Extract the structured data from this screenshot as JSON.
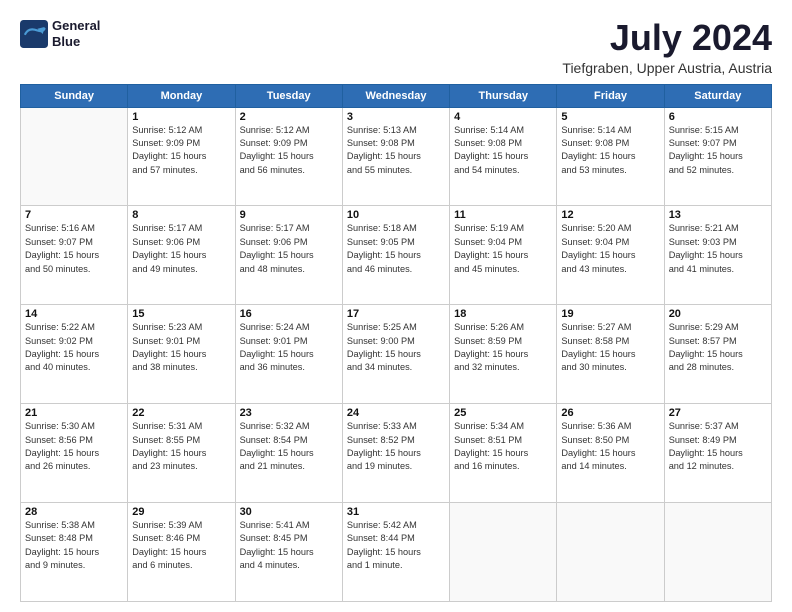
{
  "logo": {
    "line1": "General",
    "line2": "Blue"
  },
  "title": "July 2024",
  "subtitle": "Tiefgraben, Upper Austria, Austria",
  "days_header": [
    "Sunday",
    "Monday",
    "Tuesday",
    "Wednesday",
    "Thursday",
    "Friday",
    "Saturday"
  ],
  "weeks": [
    [
      {
        "day": "",
        "info": ""
      },
      {
        "day": "1",
        "info": "Sunrise: 5:12 AM\nSunset: 9:09 PM\nDaylight: 15 hours\nand 57 minutes."
      },
      {
        "day": "2",
        "info": "Sunrise: 5:12 AM\nSunset: 9:09 PM\nDaylight: 15 hours\nand 56 minutes."
      },
      {
        "day": "3",
        "info": "Sunrise: 5:13 AM\nSunset: 9:08 PM\nDaylight: 15 hours\nand 55 minutes."
      },
      {
        "day": "4",
        "info": "Sunrise: 5:14 AM\nSunset: 9:08 PM\nDaylight: 15 hours\nand 54 minutes."
      },
      {
        "day": "5",
        "info": "Sunrise: 5:14 AM\nSunset: 9:08 PM\nDaylight: 15 hours\nand 53 minutes."
      },
      {
        "day": "6",
        "info": "Sunrise: 5:15 AM\nSunset: 9:07 PM\nDaylight: 15 hours\nand 52 minutes."
      }
    ],
    [
      {
        "day": "7",
        "info": "Sunrise: 5:16 AM\nSunset: 9:07 PM\nDaylight: 15 hours\nand 50 minutes."
      },
      {
        "day": "8",
        "info": "Sunrise: 5:17 AM\nSunset: 9:06 PM\nDaylight: 15 hours\nand 49 minutes."
      },
      {
        "day": "9",
        "info": "Sunrise: 5:17 AM\nSunset: 9:06 PM\nDaylight: 15 hours\nand 48 minutes."
      },
      {
        "day": "10",
        "info": "Sunrise: 5:18 AM\nSunset: 9:05 PM\nDaylight: 15 hours\nand 46 minutes."
      },
      {
        "day": "11",
        "info": "Sunrise: 5:19 AM\nSunset: 9:04 PM\nDaylight: 15 hours\nand 45 minutes."
      },
      {
        "day": "12",
        "info": "Sunrise: 5:20 AM\nSunset: 9:04 PM\nDaylight: 15 hours\nand 43 minutes."
      },
      {
        "day": "13",
        "info": "Sunrise: 5:21 AM\nSunset: 9:03 PM\nDaylight: 15 hours\nand 41 minutes."
      }
    ],
    [
      {
        "day": "14",
        "info": "Sunrise: 5:22 AM\nSunset: 9:02 PM\nDaylight: 15 hours\nand 40 minutes."
      },
      {
        "day": "15",
        "info": "Sunrise: 5:23 AM\nSunset: 9:01 PM\nDaylight: 15 hours\nand 38 minutes."
      },
      {
        "day": "16",
        "info": "Sunrise: 5:24 AM\nSunset: 9:01 PM\nDaylight: 15 hours\nand 36 minutes."
      },
      {
        "day": "17",
        "info": "Sunrise: 5:25 AM\nSunset: 9:00 PM\nDaylight: 15 hours\nand 34 minutes."
      },
      {
        "day": "18",
        "info": "Sunrise: 5:26 AM\nSunset: 8:59 PM\nDaylight: 15 hours\nand 32 minutes."
      },
      {
        "day": "19",
        "info": "Sunrise: 5:27 AM\nSunset: 8:58 PM\nDaylight: 15 hours\nand 30 minutes."
      },
      {
        "day": "20",
        "info": "Sunrise: 5:29 AM\nSunset: 8:57 PM\nDaylight: 15 hours\nand 28 minutes."
      }
    ],
    [
      {
        "day": "21",
        "info": "Sunrise: 5:30 AM\nSunset: 8:56 PM\nDaylight: 15 hours\nand 26 minutes."
      },
      {
        "day": "22",
        "info": "Sunrise: 5:31 AM\nSunset: 8:55 PM\nDaylight: 15 hours\nand 23 minutes."
      },
      {
        "day": "23",
        "info": "Sunrise: 5:32 AM\nSunset: 8:54 PM\nDaylight: 15 hours\nand 21 minutes."
      },
      {
        "day": "24",
        "info": "Sunrise: 5:33 AM\nSunset: 8:52 PM\nDaylight: 15 hours\nand 19 minutes."
      },
      {
        "day": "25",
        "info": "Sunrise: 5:34 AM\nSunset: 8:51 PM\nDaylight: 15 hours\nand 16 minutes."
      },
      {
        "day": "26",
        "info": "Sunrise: 5:36 AM\nSunset: 8:50 PM\nDaylight: 15 hours\nand 14 minutes."
      },
      {
        "day": "27",
        "info": "Sunrise: 5:37 AM\nSunset: 8:49 PM\nDaylight: 15 hours\nand 12 minutes."
      }
    ],
    [
      {
        "day": "28",
        "info": "Sunrise: 5:38 AM\nSunset: 8:48 PM\nDaylight: 15 hours\nand 9 minutes."
      },
      {
        "day": "29",
        "info": "Sunrise: 5:39 AM\nSunset: 8:46 PM\nDaylight: 15 hours\nand 6 minutes."
      },
      {
        "day": "30",
        "info": "Sunrise: 5:41 AM\nSunset: 8:45 PM\nDaylight: 15 hours\nand 4 minutes."
      },
      {
        "day": "31",
        "info": "Sunrise: 5:42 AM\nSunset: 8:44 PM\nDaylight: 15 hours\nand 1 minute."
      },
      {
        "day": "",
        "info": ""
      },
      {
        "day": "",
        "info": ""
      },
      {
        "day": "",
        "info": ""
      }
    ]
  ]
}
